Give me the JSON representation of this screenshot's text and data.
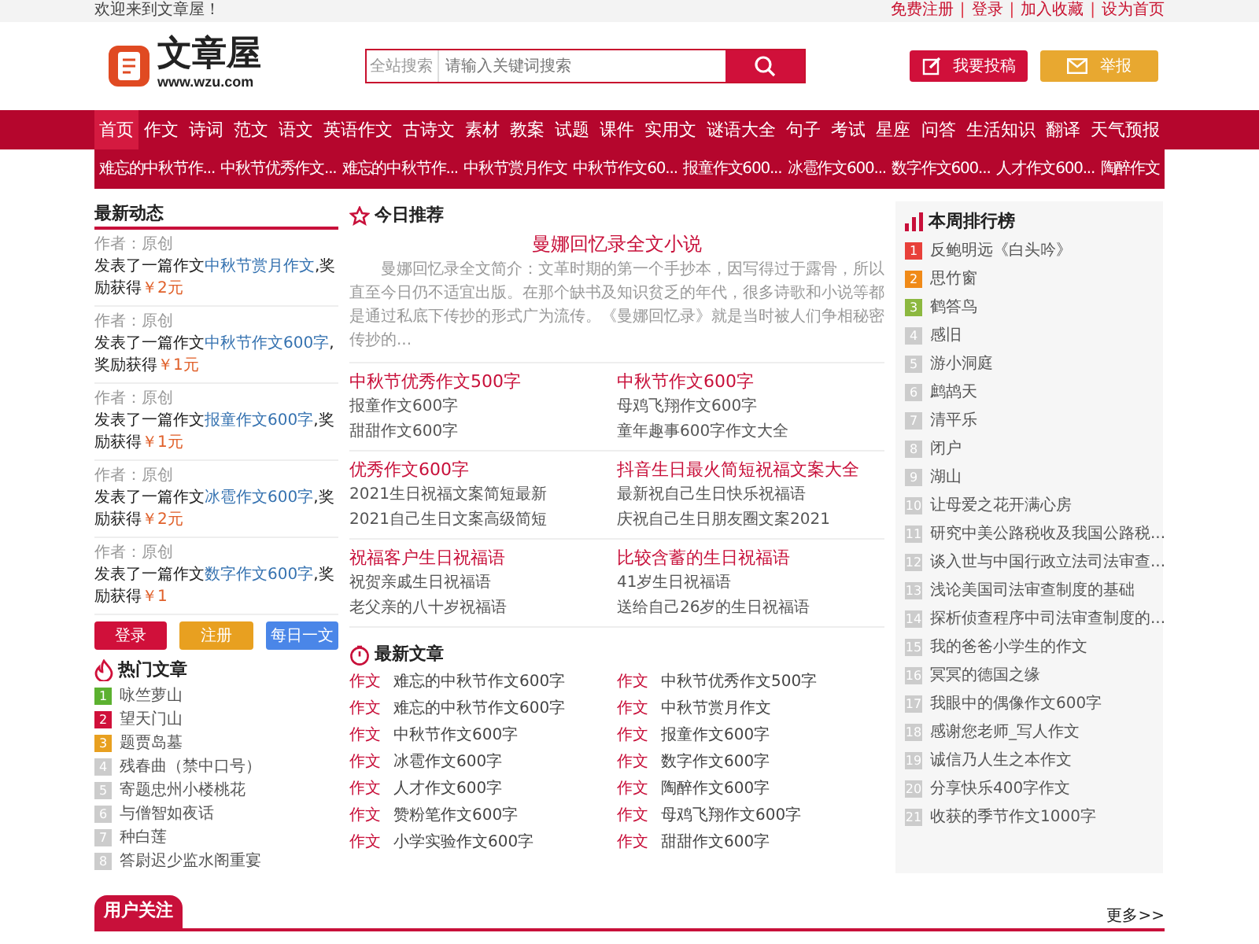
{
  "top_bar": {
    "welcome": "欢迎来到文章屋！",
    "links": [
      {
        "label": "免费注册"
      },
      {
        "label": "登录"
      },
      {
        "label": "加入收藏"
      },
      {
        "label": "设为首页"
      }
    ],
    "separator": "|"
  },
  "header": {
    "logo_text": "文章屋",
    "logo_url": "www.wzu.com",
    "search": {
      "scope": "全站搜索",
      "placeholder": "请输入关键词搜索"
    },
    "buttons": [
      {
        "label": "我要投稿",
        "kind": "submit"
      },
      {
        "label": "举报",
        "kind": "report"
      }
    ]
  },
  "nav": [
    {
      "label": "首页",
      "selected": true
    },
    {
      "label": "作文",
      "selected": false
    },
    {
      "label": "诗词",
      "selected": false
    },
    {
      "label": "范文",
      "selected": false
    },
    {
      "label": "语文",
      "selected": false
    },
    {
      "label": "英语作文",
      "selected": false
    },
    {
      "label": "古诗文",
      "selected": false
    },
    {
      "label": "素材",
      "selected": false
    },
    {
      "label": "教案",
      "selected": false
    },
    {
      "label": "试题",
      "selected": false
    },
    {
      "label": "课件",
      "selected": false
    },
    {
      "label": "实用文",
      "selected": false
    },
    {
      "label": "谜语大全",
      "selected": false
    },
    {
      "label": "句子",
      "selected": false
    },
    {
      "label": "考试",
      "selected": false
    },
    {
      "label": "星座",
      "selected": false
    },
    {
      "label": "问答",
      "selected": false
    },
    {
      "label": "生活知识",
      "selected": false
    },
    {
      "label": "翻译",
      "selected": false
    },
    {
      "label": "天气预报",
      "selected": false
    }
  ],
  "sub_nav": [
    "难忘的中秋节作...",
    "中秋节优秀作文...",
    "难忘的中秋节作...",
    "中秋节赏月作文",
    "中秋节作文60...",
    "报童作文600...",
    "冰雹作文600...",
    "数字作文600...",
    "人才作文600...",
    "陶醉作文"
  ],
  "latest_activity": {
    "title": "最新动态",
    "items": [
      {
        "author": "作者：原创",
        "prefix": "发表了一篇作文",
        "link": "中秋节赏月作文",
        "suffix": ",奖励获得",
        "reward": "￥2元"
      },
      {
        "author": "作者：原创",
        "prefix": "发表了一篇作文",
        "link": "中秋节作文600字",
        "suffix": ",奖励获得",
        "reward": "￥1元"
      },
      {
        "author": "作者：原创",
        "prefix": "发表了一篇作文",
        "link": "报童作文600字",
        "suffix": ",奖励获得",
        "reward": "￥1元"
      },
      {
        "author": "作者：原创",
        "prefix": "发表了一篇作文",
        "link": "冰雹作文600字",
        "suffix": ",奖励获得",
        "reward": "￥2元"
      },
      {
        "author": "作者：原创",
        "prefix": "发表了一篇作文",
        "link": "数字作文600字",
        "suffix": ",奖励获得",
        "reward": "￥1"
      }
    ],
    "buttons": [
      {
        "label": "登录",
        "kind": "login"
      },
      {
        "label": "注册",
        "kind": "register"
      },
      {
        "label": "每日一文",
        "kind": "daily"
      }
    ]
  },
  "hot_articles": {
    "title": "热门文章",
    "items": [
      {
        "num": "1",
        "title": "咏竺萝山",
        "color": "#5cb130"
      },
      {
        "num": "2",
        "title": "望天门山",
        "color": "#d0103a"
      },
      {
        "num": "3",
        "title": "题贾岛墓",
        "color": "#e8a020"
      },
      {
        "num": "4",
        "title": "残春曲（禁中口号）",
        "color": "#cccccc"
      },
      {
        "num": "5",
        "title": "寄题忠州小楼桃花",
        "color": "#cccccc"
      },
      {
        "num": "6",
        "title": "与僧智如夜话",
        "color": "#cccccc"
      },
      {
        "num": "7",
        "title": "种白莲",
        "color": "#cccccc"
      },
      {
        "num": "8",
        "title": "答尉迟少监水阁重宴",
        "color": "#cccccc"
      }
    ]
  },
  "today": {
    "title": "今日推荐",
    "headline": "曼娜回忆录全文小说",
    "summary": "曼娜回忆录全文简介：文革时期的第一个手抄本，因写得过于露骨，所以直至今日仍不适宜出版。在那个缺书及知识贫乏的年代，很多诗歌和小说等都是通过私底下传抄的形式广为流传。《曼娜回忆录》就是当时被人们争相秘密传抄的...",
    "groups": [
      {
        "title": "中秋节优秀作文500字",
        "items": [
          "报童作文600字",
          "甜甜作文600字"
        ]
      },
      {
        "title": "中秋节作文600字",
        "items": [
          "母鸡飞翔作文600字",
          "童年趣事600字作文大全"
        ]
      },
      {
        "title": "优秀作文600字",
        "items": [
          "2021生日祝福文案简短最新",
          "2021自己生日文案高级简短"
        ]
      },
      {
        "title": "抖音生日最火简短祝福文案大全",
        "items": [
          "最新祝自己生日快乐祝福语",
          "庆祝自己生日朋友圈文案2021"
        ]
      },
      {
        "title": "祝福客户生日祝福语",
        "items": [
          "祝贺亲戚生日祝福语",
          "老父亲的八十岁祝福语"
        ]
      },
      {
        "title": "比较含蓄的生日祝福语",
        "items": [
          "41岁生日祝福语",
          "送给自己26岁的生日祝福语"
        ]
      }
    ]
  },
  "latest_articles": {
    "title": "最新文章",
    "items": [
      {
        "tag": "作文",
        "title": "难忘的中秋节作文600字"
      },
      {
        "tag": "作文",
        "title": "中秋节优秀作文500字"
      },
      {
        "tag": "作文",
        "title": "难忘的中秋节作文600字"
      },
      {
        "tag": "作文",
        "title": "中秋节赏月作文"
      },
      {
        "tag": "作文",
        "title": "中秋节作文600字"
      },
      {
        "tag": "作文",
        "title": "报童作文600字"
      },
      {
        "tag": "作文",
        "title": "冰雹作文600字"
      },
      {
        "tag": "作文",
        "title": "数字作文600字"
      },
      {
        "tag": "作文",
        "title": "人才作文600字"
      },
      {
        "tag": "作文",
        "title": "陶醉作文600字"
      },
      {
        "tag": "作文",
        "title": "赞粉笔作文600字"
      },
      {
        "tag": "作文",
        "title": "母鸡飞翔作文600字"
      },
      {
        "tag": "作文",
        "title": "小学实验作文600字"
      },
      {
        "tag": "作文",
        "title": "甜甜作文600字"
      }
    ]
  },
  "weekly_ranking": {
    "title": "本周排行榜",
    "items": [
      {
        "num": "1",
        "title": "反鲍明远《白头吟》",
        "color": "#e8403a"
      },
      {
        "num": "2",
        "title": "思竹窗",
        "color": "#f08a18"
      },
      {
        "num": "3",
        "title": "鹤答鸟",
        "color": "#8cb840"
      },
      {
        "num": "4",
        "title": "感旧",
        "color": "#cccccc"
      },
      {
        "num": "5",
        "title": "游小洞庭",
        "color": "#cccccc"
      },
      {
        "num": "6",
        "title": "鹧鸪天",
        "color": "#cccccc"
      },
      {
        "num": "7",
        "title": "清平乐",
        "color": "#cccccc"
      },
      {
        "num": "8",
        "title": "闭户",
        "color": "#cccccc"
      },
      {
        "num": "9",
        "title": "湖山",
        "color": "#cccccc"
      },
      {
        "num": "10",
        "title": "让母爱之花开满心房",
        "color": "#cccccc"
      },
      {
        "num": "11",
        "title": "研究中美公路税收及我国公路税...",
        "color": "#cccccc"
      },
      {
        "num": "12",
        "title": "谈入世与中国行政立法司法审查...",
        "color": "#cccccc"
      },
      {
        "num": "13",
        "title": "浅论美国司法审查制度的基础",
        "color": "#cccccc"
      },
      {
        "num": "14",
        "title": "探析侦查程序中司法审查制度的...",
        "color": "#cccccc"
      },
      {
        "num": "15",
        "title": "我的爸爸小学生的作文",
        "color": "#cccccc"
      },
      {
        "num": "16",
        "title": "冥冥的德国之缘",
        "color": "#cccccc"
      },
      {
        "num": "17",
        "title": "我眼中的偶像作文600字",
        "color": "#cccccc"
      },
      {
        "num": "18",
        "title": "感谢您老师_写人作文",
        "color": "#cccccc"
      },
      {
        "num": "19",
        "title": "诚信乃人生之本作文",
        "color": "#cccccc"
      },
      {
        "num": "20",
        "title": "分享快乐400字作文",
        "color": "#cccccc"
      },
      {
        "num": "21",
        "title": "收获的季节作文1000字",
        "color": "#cccccc"
      }
    ]
  },
  "user_follow": {
    "title": "用户关注",
    "more": "更多>>"
  }
}
